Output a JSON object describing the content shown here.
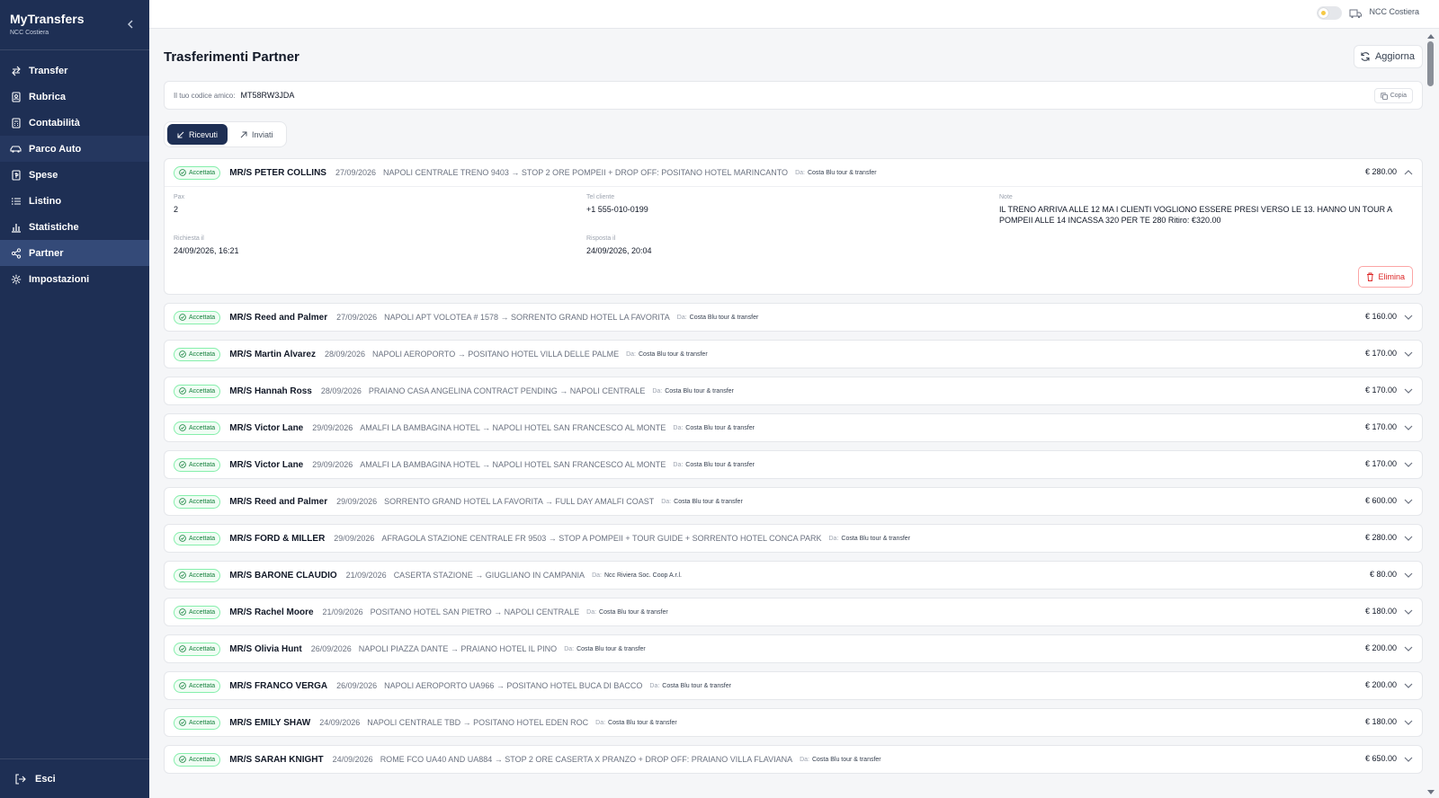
{
  "app": {
    "title": "MyTransfers",
    "company": "NCC Costiera"
  },
  "nav": [
    {
      "label": "Transfer",
      "icon": "arrows-icon"
    },
    {
      "label": "Rubrica",
      "icon": "contacts-icon"
    },
    {
      "label": "Contabilità",
      "icon": "calculator-icon"
    },
    {
      "label": "Parco Auto",
      "icon": "car-icon"
    },
    {
      "label": "Spese",
      "icon": "receipt-icon"
    },
    {
      "label": "Listino",
      "icon": "list-icon"
    },
    {
      "label": "Statistiche",
      "icon": "bar-chart-icon"
    },
    {
      "label": "Partner",
      "icon": "share-icon"
    },
    {
      "label": "Impostazioni",
      "icon": "gear-icon"
    }
  ],
  "logout_label": "Esci",
  "topbar": {
    "company": "NCC Costiera"
  },
  "page": {
    "title": "Trasferimenti Partner",
    "refresh_label": "Aggiorna",
    "friend_label": "Il tuo codice amico:",
    "friend_code": "MT58RW3JDA",
    "copy_label": "Copia"
  },
  "tabs": [
    {
      "label": "Ricevuti",
      "active": true
    },
    {
      "label": "Inviati",
      "active": false
    }
  ],
  "from_label": "Da:",
  "transfers": [
    {
      "status": "Accettata",
      "passenger": "MR/S PETER COLLINS",
      "date": "27/09/2026",
      "route": "NAPOLI CENTRALE TRENO 9403 → STOP 2 ORE POMPEII + DROP OFF: POSITANO HOTEL MARINCANTO",
      "from": "Costa Blu tour & transfer",
      "price": "€ 280.00",
      "expanded": true,
      "details": {
        "pax_label": "Pax",
        "pax": "2",
        "phone_label": "Tel cliente",
        "phone": "+1 555-010-0199",
        "note_label": "Note",
        "note": "IL TRENO ARRIVA ALLE 12 MA I CLIENTI VOGLIONO ESSERE PRESI VERSO LE 13. HANNO UN TOUR A POMPEII ALLE 14 INCASSA 320 PER TE 280 Ritiro: €320.00",
        "requested_label": "Richiesta il",
        "requested": "24/09/2026, 16:21",
        "answered_label": "Risposta il",
        "answered": "24/09/2026, 20:04",
        "delete_label": "Elimina"
      }
    },
    {
      "status": "Accettata",
      "passenger": "MR/S Reed and Palmer",
      "date": "27/09/2026",
      "route": "NAPOLI APT VOLOTEA # 1578 → SORRENTO GRAND HOTEL LA FAVORITA",
      "from": "Costa Blu tour & transfer",
      "price": "€ 160.00"
    },
    {
      "status": "Accettata",
      "passenger": "MR/S Martin Alvarez",
      "date": "28/09/2026",
      "route": "NAPOLI AEROPORTO → POSITANO HOTEL VILLA DELLE PALME",
      "from": "Costa Blu tour & transfer",
      "price": "€ 170.00"
    },
    {
      "status": "Accettata",
      "passenger": "MR/S Hannah Ross",
      "date": "28/09/2026",
      "route": "PRAIANO CASA ANGELINA CONTRACT PENDING → NAPOLI CENTRALE",
      "from": "Costa Blu tour & transfer",
      "price": "€ 170.00"
    },
    {
      "status": "Accettata",
      "passenger": "MR/S Victor Lane",
      "date": "29/09/2026",
      "route": "AMALFI LA BAMBAGINA HOTEL → NAPOLI HOTEL SAN FRANCESCO AL MONTE",
      "from": "Costa Blu tour & transfer",
      "price": "€ 170.00"
    },
    {
      "status": "Accettata",
      "passenger": "MR/S Victor Lane",
      "date": "29/09/2026",
      "route": "AMALFI LA BAMBAGINA HOTEL → NAPOLI HOTEL SAN FRANCESCO AL MONTE",
      "from": "Costa Blu tour & transfer",
      "price": "€ 170.00"
    },
    {
      "status": "Accettata",
      "passenger": "MR/S Reed and Palmer",
      "date": "29/09/2026",
      "route": "SORRENTO GRAND HOTEL LA FAVORITA → FULL DAY AMALFI COAST",
      "from": "Costa Blu tour & transfer",
      "price": "€ 600.00"
    },
    {
      "status": "Accettata",
      "passenger": "MR/S FORD & MILLER",
      "date": "29/09/2026",
      "route": "AFRAGOLA STAZIONE CENTRALE FR 9503 → STOP A POMPEII + TOUR GUIDE + SORRENTO HOTEL CONCA PARK",
      "from": "Costa Blu tour & transfer",
      "price": "€ 280.00"
    },
    {
      "status": "Accettata",
      "passenger": "MR/S BARONE CLAUDIO",
      "date": "21/09/2026",
      "route": "CASERTA STAZIONE → GIUGLIANO IN CAMPANIA",
      "from": "Ncc Riviera Soc. Coop A.r.l.",
      "price": "€ 80.00"
    },
    {
      "status": "Accettata",
      "passenger": "MR/S Rachel Moore",
      "date": "21/09/2026",
      "route": "POSITANO HOTEL SAN PIETRO → NAPOLI CENTRALE",
      "from": "Costa Blu tour & transfer",
      "price": "€ 180.00"
    },
    {
      "status": "Accettata",
      "passenger": "MR/S Olivia Hunt",
      "date": "26/09/2026",
      "route": "NAPOLI PIAZZA DANTE → PRAIANO HOTEL IL PINO",
      "from": "Costa Blu tour & transfer",
      "price": "€ 200.00"
    },
    {
      "status": "Accettata",
      "passenger": "MR/S FRANCO VERGA",
      "date": "26/09/2026",
      "route": "NAPOLI AEROPORTO UA966 → POSITANO HOTEL BUCA DI BACCO",
      "from": "Costa Blu tour & transfer",
      "price": "€ 200.00"
    },
    {
      "status": "Accettata",
      "passenger": "MR/S EMILY SHAW",
      "date": "24/09/2026",
      "route": "NAPOLI CENTRALE TBD → POSITANO HOTEL EDEN ROC",
      "from": "Costa Blu tour & transfer",
      "price": "€ 180.00"
    },
    {
      "status": "Accettata",
      "passenger": "MR/S SARAH KNIGHT",
      "date": "24/09/2026",
      "route": "ROME FCO UA40 AND UA884 → STOP 2 ORE CASERTA X PRANZO + DROP OFF: PRAIANO VILLA FLAVIANA",
      "from": "Costa Blu tour & transfer",
      "price": "€ 650.00"
    }
  ]
}
